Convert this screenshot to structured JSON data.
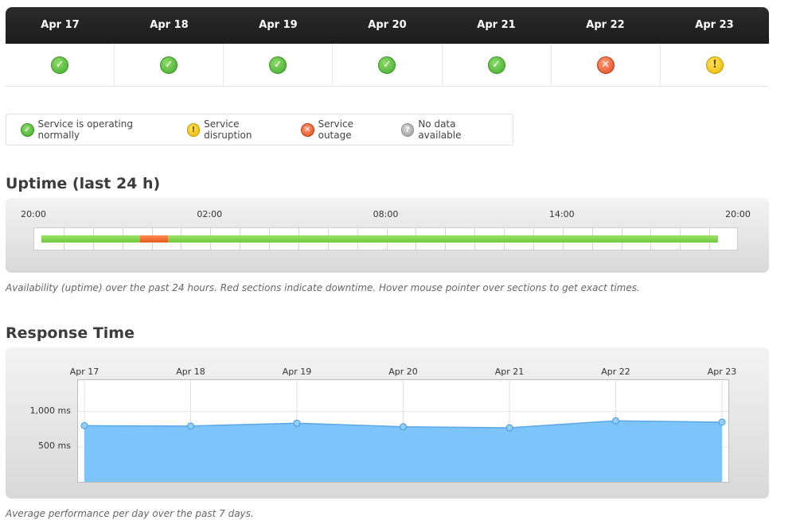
{
  "status": {
    "days": [
      {
        "date": "Apr 17",
        "state": "ok"
      },
      {
        "date": "Apr 18",
        "state": "ok"
      },
      {
        "date": "Apr 19",
        "state": "ok"
      },
      {
        "date": "Apr 20",
        "state": "ok"
      },
      {
        "date": "Apr 21",
        "state": "ok"
      },
      {
        "date": "Apr 22",
        "state": "outage"
      },
      {
        "date": "Apr 23",
        "state": "disruption"
      }
    ]
  },
  "icons": {
    "ok": "check-circle-icon",
    "disruption": "exclamation-circle-icon",
    "outage": "x-circle-icon",
    "nodata": "question-circle-icon"
  },
  "colors": {
    "ok": "#4cb82f",
    "disruption": "#f0c000",
    "outage": "#e5531f",
    "nodata": "#a6a6a6",
    "uptime_up": "#7ed24a",
    "uptime_down": "#f06a2e",
    "response_fill": "#7cc4fa",
    "response_line": "#5aa8e8"
  },
  "legend": {
    "ok": "Service is operating normally",
    "disruption": "Service disruption",
    "outage": "Service outage",
    "nodata": "No data available"
  },
  "uptime": {
    "title": "Uptime (last 24 h)",
    "caption": "Availability (uptime) over the past 24 hours. Red sections indicate downtime. Hover mouse pointer over sections to get exact times.",
    "tick_labels": [
      "20:00",
      "02:00",
      "08:00",
      "14:00",
      "20:00"
    ],
    "segments": [
      {
        "state": "up",
        "start_hour": 0.25,
        "end_hour": 3.6
      },
      {
        "state": "down",
        "start_hour": 3.6,
        "end_hour": 4.55
      },
      {
        "state": "up",
        "start_hour": 4.55,
        "end_hour": 23.3
      }
    ]
  },
  "response": {
    "title": "Response Time",
    "caption": "Average performance per day over the past 7 days.",
    "chart_data": {
      "type": "area",
      "categories": [
        "Apr 17",
        "Apr 18",
        "Apr 19",
        "Apr 20",
        "Apr 21",
        "Apr 22",
        "Apr 23"
      ],
      "values": [
        800,
        795,
        835,
        785,
        770,
        870,
        850
      ],
      "y_ticks": [
        {
          "value": 1000,
          "label": "1,000 ms"
        },
        {
          "value": 500,
          "label": "500 ms"
        }
      ],
      "ylim": [
        0,
        1450
      ],
      "grid": true
    }
  }
}
